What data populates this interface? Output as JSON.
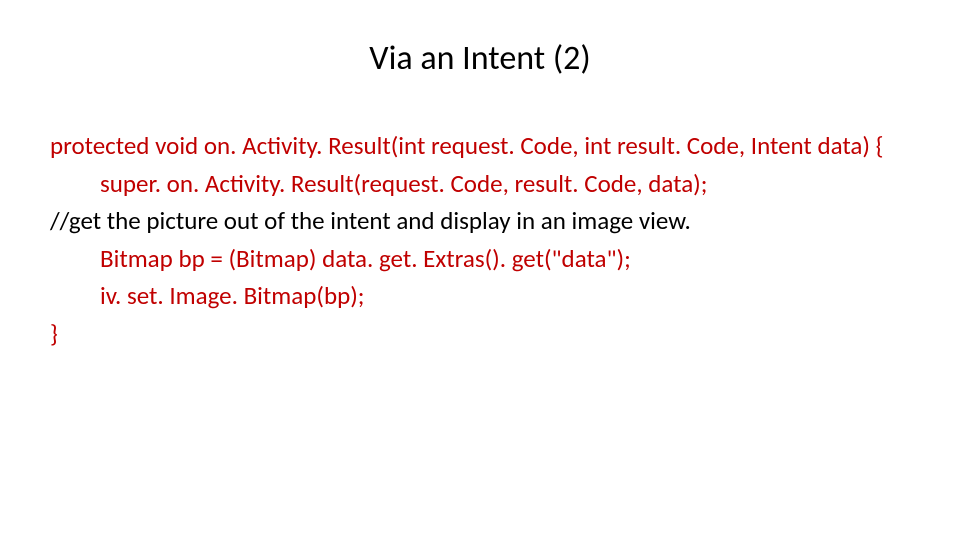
{
  "title": "Via an Intent (2)",
  "lines": {
    "l1": "protected void on. Activity. Result(int request. Code, int result. Code, Intent data) {",
    "l2": "super. on. Activity. Result(request. Code, result. Code, data);",
    "l3": "//get the picture out of the intent and display in an image view.",
    "l4": "Bitmap bp = (Bitmap) data. get. Extras(). get(\"data\");",
    "l5": "iv. set. Image. Bitmap(bp);",
    "l6": "}"
  }
}
